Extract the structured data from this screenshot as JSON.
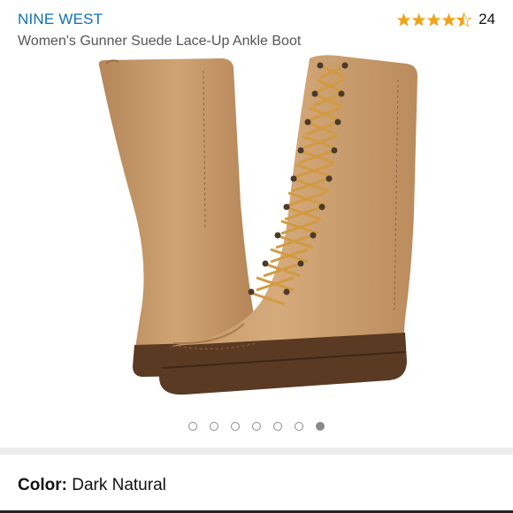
{
  "header": {
    "brand": "NINE WEST",
    "title": "Women's Gunner Suede Lace-Up Ankle Boot"
  },
  "rating": {
    "stars": 4.5,
    "count": "24",
    "star_color": "#f0a41a",
    "star_icon": "star-icon"
  },
  "gallery": {
    "image_alt": "Tan suede lace-up mid-calf boots",
    "dot_count": 7,
    "active_index": 6
  },
  "variant": {
    "label": "Color:",
    "value": "Dark Natural"
  },
  "colors": {
    "brand": "#0f6fb3",
    "suede": "#c89b6c",
    "sole": "#5a3a22",
    "lace": "#d19a42"
  }
}
